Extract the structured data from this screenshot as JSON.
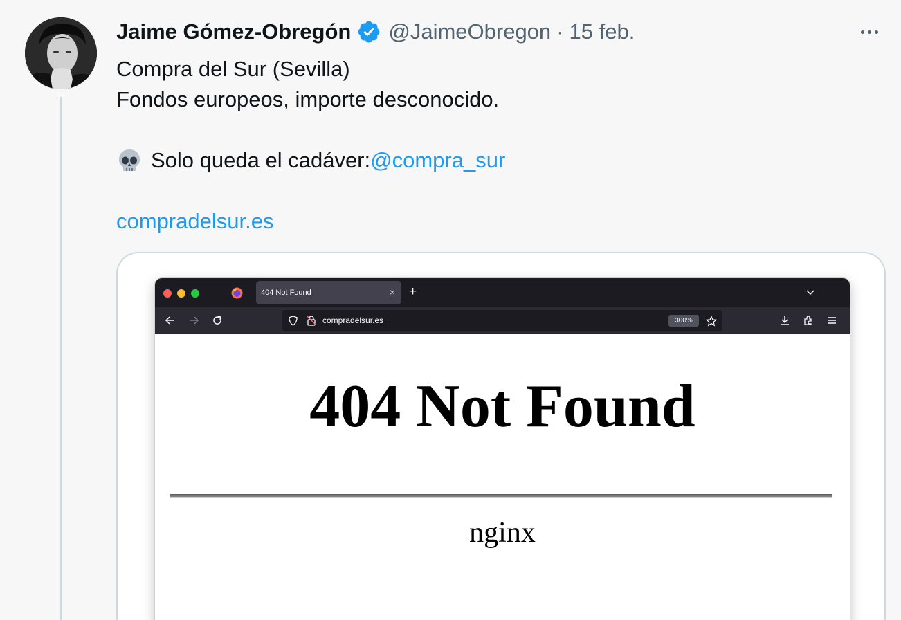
{
  "tweet": {
    "author_name": "Jaime Gómez-Obregón",
    "author_handle": "@JaimeObregon",
    "separator": "·",
    "date": "15 feb.",
    "lines": {
      "line1": "Compra del Sur (Sevilla)",
      "line2": "Fondos europeos, importe desconocido.",
      "line3_text": "Solo queda el cadáver: ",
      "line3_mention": "@compra_sur",
      "link": "compradelsur.es"
    },
    "icons": {
      "verified": "verified-badge-icon",
      "skull": "skull-emoji",
      "more": "more-options-icon"
    }
  },
  "browser": {
    "tab_title": "404 Not Found",
    "tab_close": "×",
    "new_tab": "+",
    "url": "compradelsur.es",
    "zoom": "300%",
    "page": {
      "heading": "404 Not Found",
      "footer": "nginx"
    }
  },
  "colors": {
    "background": "#f7f7f7",
    "link": "#1d9bf0",
    "secondary_text": "#536471",
    "verified": "#1d9bf0",
    "browser_tabbar": "#1c1b22",
    "browser_navbar": "#2b2a33"
  }
}
